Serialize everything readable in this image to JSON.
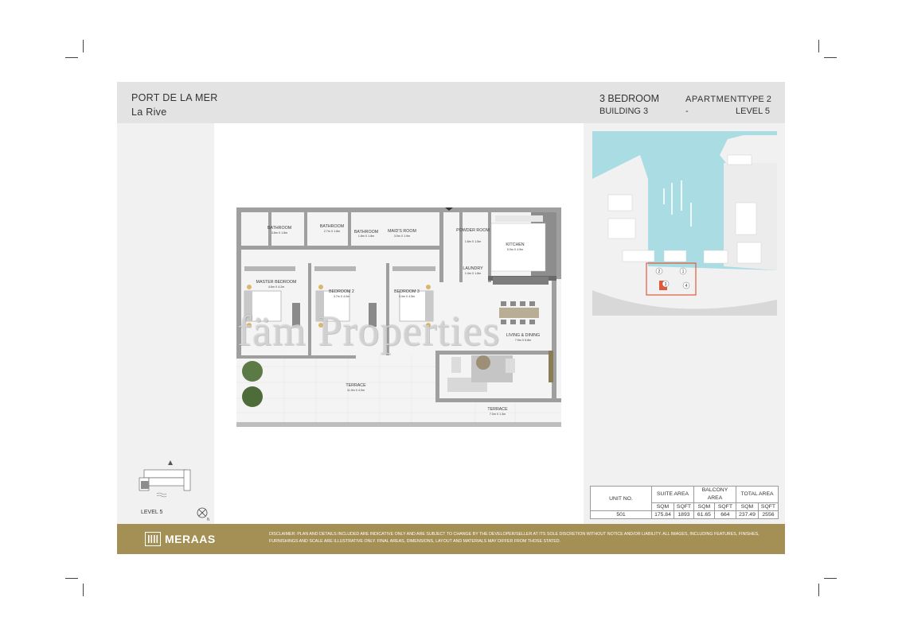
{
  "header": {
    "project": "PORT DE LA MER",
    "subproject": "La Rive",
    "unit_type": "3 BEDROOM",
    "building": "BUILDING 3",
    "apartment_label": "APARTMENT",
    "apartment_type": "TYPE 2",
    "dash": "-",
    "level": "LEVEL 5"
  },
  "floor_plan": {
    "rooms": [
      {
        "name": "BATHROOM",
        "dims": "3.6m X 1.8m"
      },
      {
        "name": "BATHROOM",
        "dims": "2.7m X 1.8m"
      },
      {
        "name": "BATHROOM",
        "dims": "1.8m X 1.8m"
      },
      {
        "name": "MAID'S ROOM",
        "dims": "3.0m X 1.9m"
      },
      {
        "name": "POWDER ROOM",
        "dims": "1.8m X 1.5m"
      },
      {
        "name": "KITCHEN",
        "dims": "5.9m X 4.9m"
      },
      {
        "name": "LAUNDRY",
        "dims": "1.4m X 1.8m"
      },
      {
        "name": "MASTER BEDROOM",
        "dims": "4.6m X 4.2m"
      },
      {
        "name": "BEDROOM 2",
        "dims": "3.7m X 4.0m"
      },
      {
        "name": "BEDROOM 3",
        "dims": "3.4m X 4.5m"
      },
      {
        "name": "LIVING & DINING",
        "dims": "7.9m X 6.8m"
      },
      {
        "name": "TERRACE",
        "dims": "11.9m X 4.0m"
      },
      {
        "name": "TERRACE",
        "dims": "7.0m X 1.3m"
      }
    ]
  },
  "key_plan": {
    "level_label": "LEVEL 5"
  },
  "area_table": {
    "unit_header": "UNIT NO.",
    "suite_header": "SUITE AREA",
    "balcony_header": "BALCONY AREA",
    "total_header": "TOTAL AREA",
    "sqm": "SQM",
    "sqft": "SQFT",
    "unit": "501",
    "suite_sqm": "175.84",
    "suite_sqft": "1893",
    "balcony_sqm": "61.65",
    "balcony_sqft": "664",
    "total_sqm": "237.49",
    "total_sqft": "2556"
  },
  "footer": {
    "brand": "MERAAS",
    "disclaimer": "DISCLAIMER: PLAN AND DETAILS INCLUDED ARE INDICATIVE ONLY AND ARE SUBJECT TO CHANGE BY THE DEVELOPER/SELLER AT ITS SOLE DISCRETION WITHOUT NOTICE AND/OR LIABILITY. ALL IMAGES, INCLUDING FEATURES, FINISHES, FURNISHINGS AND SCALE ARE ILLUSTRATIVE ONLY. FINAL AREAS, DIMENSIONS, LAYOUT AND MATERIALS MAY DIFFER FROM THOSE STATED."
  },
  "watermark": "fäm Properties",
  "colors": {
    "header_bg": "#e3e3e3",
    "panel_bg": "#f1f1f1",
    "footer_gold": "#a48f54",
    "sea": "#a9dde3",
    "highlight": "#e05a3a"
  }
}
